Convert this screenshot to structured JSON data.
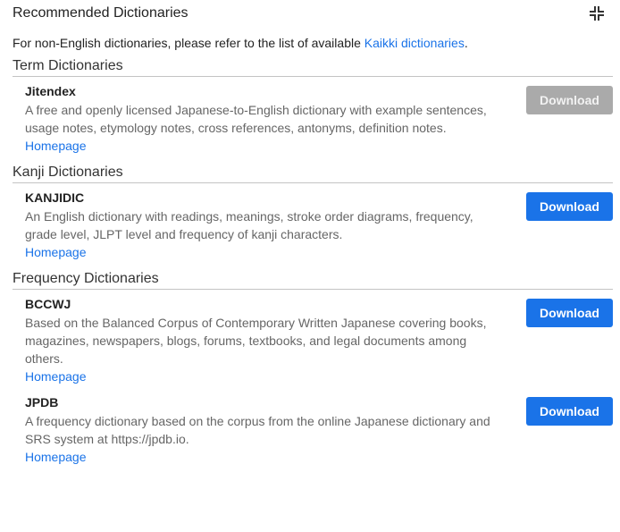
{
  "header": {
    "title": "Recommended Dictionaries",
    "collapse_icon": "collapse-icon"
  },
  "intro": {
    "text_before": "For non-English dictionaries, please refer to the list of available ",
    "link_text": "Kaikki dictionaries",
    "text_after": "."
  },
  "sections": [
    {
      "title": "Term Dictionaries",
      "items": [
        {
          "name": "Jitendex",
          "description": "A free and openly licensed Japanese-to-English dictionary with example sentences, usage notes, etymology notes, cross references, antonyms, definition notes.",
          "homepage": "Homepage",
          "download": "Download",
          "download_state": "disabled"
        }
      ]
    },
    {
      "title": "Kanji Dictionaries",
      "items": [
        {
          "name": "KANJIDIC",
          "description": "An English dictionary with readings, meanings, stroke order diagrams, frequency, grade level, JLPT level and frequency of kanji characters.",
          "homepage": "Homepage",
          "download": "Download",
          "download_state": "enabled"
        }
      ]
    },
    {
      "title": "Frequency Dictionaries",
      "items": [
        {
          "name": "BCCWJ",
          "description": "Based on the Balanced Corpus of Contemporary Written Japanese covering books, magazines, newspapers, blogs, forums, textbooks, and legal documents among others.",
          "homepage": "Homepage",
          "download": "Download",
          "download_state": "enabled"
        },
        {
          "name": "JPDB",
          "description": "A frequency dictionary based on the corpus from the online Japanese dictionary and SRS system at https://jpdb.io.",
          "homepage": "Homepage",
          "download": "Download",
          "download_state": "enabled"
        }
      ]
    }
  ],
  "colors": {
    "accent": "#1a73e8",
    "disabled_button": "#aaaaaa",
    "description_text": "#666666",
    "divider": "#c4c4c4"
  }
}
